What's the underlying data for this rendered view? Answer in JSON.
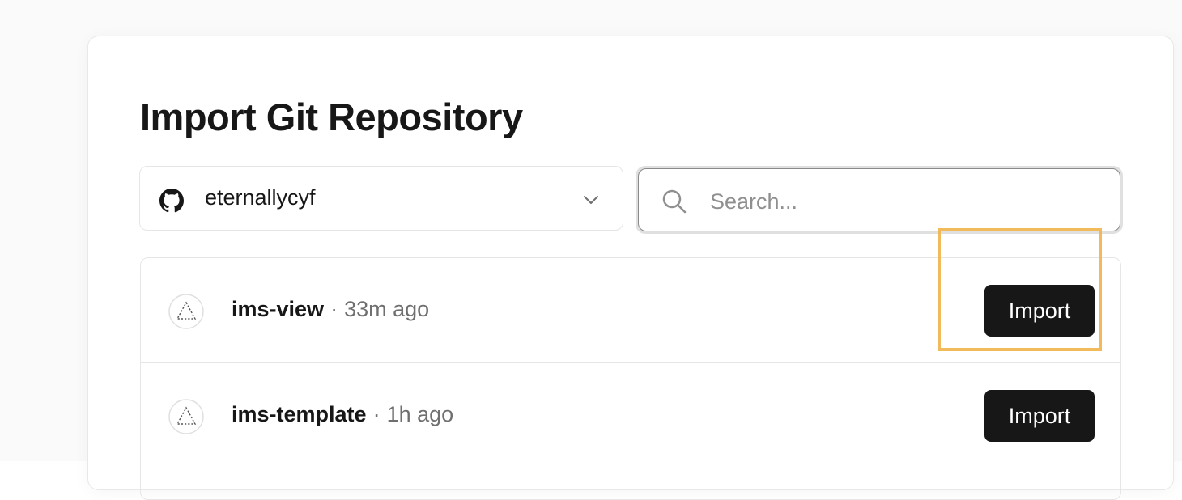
{
  "page": {
    "title": "Import Git Repository"
  },
  "scope_selector": {
    "account": "eternallycyf",
    "provider_icon": "github-icon",
    "chevron_icon": "chevron-down-icon"
  },
  "search": {
    "placeholder": "Search...",
    "value": "",
    "icon": "search-icon"
  },
  "repositories": [
    {
      "name": "ims-view",
      "separator": "·",
      "updated": "33m ago",
      "icon": "triangle-outline-icon",
      "action_label": "Import"
    },
    {
      "name": "ims-template",
      "separator": "·",
      "updated": "1h ago",
      "icon": "triangle-outline-icon",
      "action_label": "Import"
    }
  ],
  "colors": {
    "text_primary": "#171717",
    "text_secondary": "#6f6f6f",
    "button_bg": "#171717",
    "button_text": "#ffffff",
    "highlight": "#f0b44a",
    "border": "#e6e6e6"
  }
}
